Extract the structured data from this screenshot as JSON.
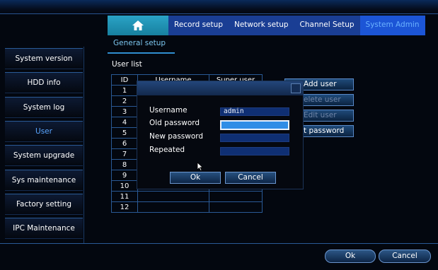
{
  "tabs": {
    "home_icon": "home-icon",
    "items": [
      "Record setup",
      "Network setup",
      "Channel Setup",
      "System Admin"
    ]
  },
  "subtab": "General setup",
  "sidebar": {
    "items": [
      "System version",
      "HDD info",
      "System log",
      "User",
      "System upgrade",
      "Sys maintenance",
      "Factory setting",
      "IPC Maintenance"
    ]
  },
  "user_list": {
    "title": "User list",
    "headers": [
      "ID",
      "Username",
      "Super user"
    ],
    "ids": [
      "1",
      "2",
      "3",
      "4",
      "5",
      "6",
      "7",
      "8",
      "9",
      "10",
      "11",
      "12"
    ]
  },
  "right_buttons": [
    "Add user",
    "elete user",
    "Edit user",
    "t password"
  ],
  "dialog": {
    "username_label": "Username",
    "username_value": "admin",
    "old_password_label": "Old password",
    "new_password_label": "New password",
    "repeated_label": "Repeated",
    "ok": "Ok",
    "cancel": "Cancel"
  },
  "footer": {
    "ok": "Ok",
    "cancel": "Cancel"
  },
  "colors": {
    "accent": "#1c55d6",
    "active_text": "#5aa6ff",
    "focus_field": "#2f8de6"
  }
}
